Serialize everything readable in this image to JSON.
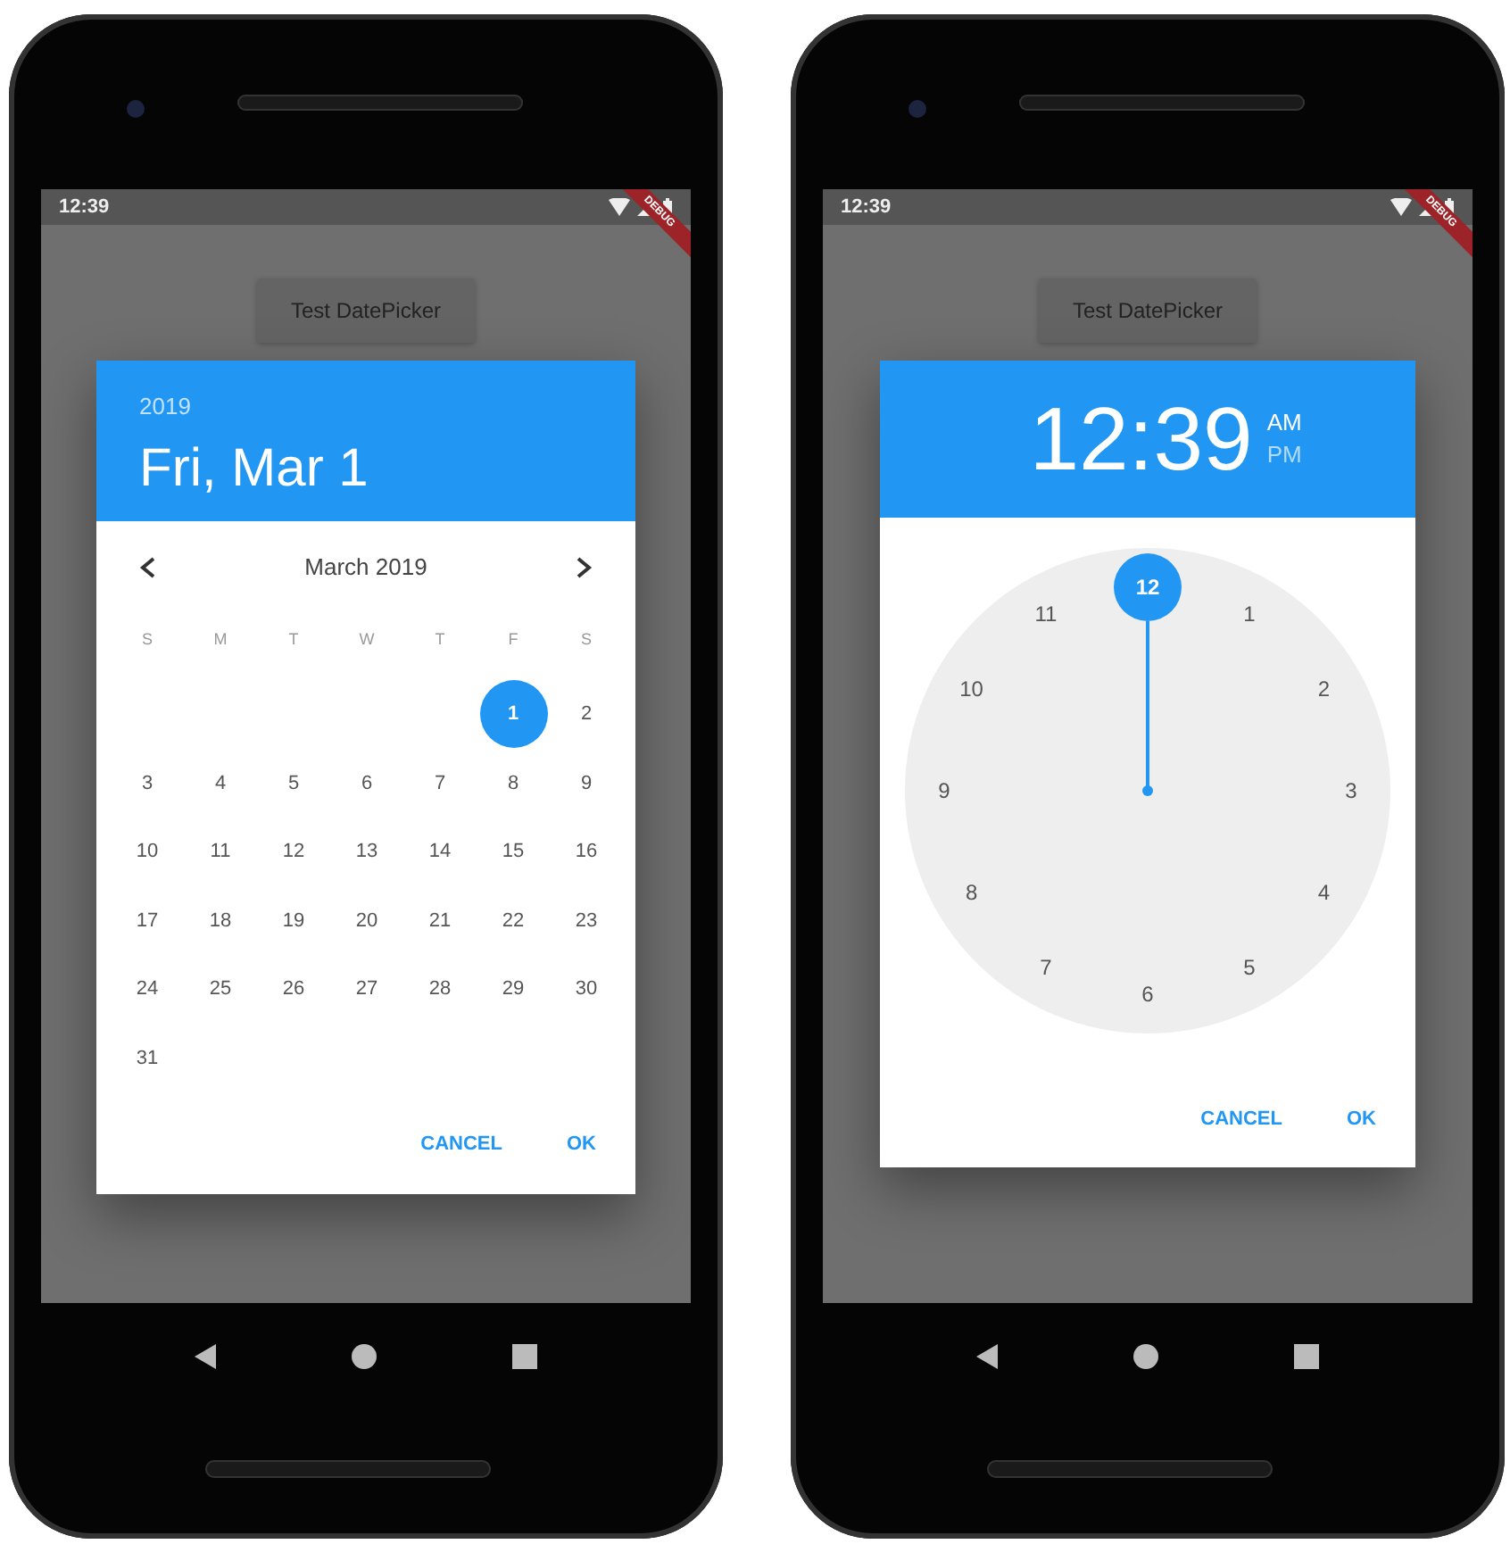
{
  "phones": [
    {
      "status_bar": {
        "time": "12:39",
        "banner": "DEBUG"
      },
      "button": "Test DatePicker",
      "dialog": {
        "kind": "date",
        "year": "2019",
        "date": "Fri, Mar 1",
        "month_label": "March 2019",
        "weekdays": [
          "S",
          "M",
          "T",
          "W",
          "T",
          "F",
          "S"
        ],
        "weeks": [
          [
            {
              "day": "1",
              "selected": true
            },
            {
              "day": "2",
              "selected": false
            }
          ],
          [
            {
              "day": "3",
              "selected": false
            },
            {
              "day": "4",
              "selected": false
            },
            {
              "day": "5",
              "selected": false
            },
            {
              "day": "6",
              "selected": false
            },
            {
              "day": "7",
              "selected": false
            },
            {
              "day": "8",
              "selected": false
            },
            {
              "day": "9",
              "selected": false
            }
          ],
          [
            {
              "day": "10",
              "selected": false
            },
            {
              "day": "11",
              "selected": false
            },
            {
              "day": "12",
              "selected": false
            },
            {
              "day": "13",
              "selected": false
            },
            {
              "day": "14",
              "selected": false
            },
            {
              "day": "15",
              "selected": false
            },
            {
              "day": "16",
              "selected": false
            }
          ],
          [
            {
              "day": "17",
              "selected": false
            },
            {
              "day": "18",
              "selected": false
            },
            {
              "day": "19",
              "selected": false
            },
            {
              "day": "20",
              "selected": false
            },
            {
              "day": "21",
              "selected": false
            },
            {
              "day": "22",
              "selected": false
            },
            {
              "day": "23",
              "selected": false
            }
          ],
          [
            {
              "day": "24",
              "selected": false
            },
            {
              "day": "25",
              "selected": false
            },
            {
              "day": "26",
              "selected": false
            },
            {
              "day": "27",
              "selected": false
            },
            {
              "day": "28",
              "selected": false
            },
            {
              "day": "29",
              "selected": false
            },
            {
              "day": "30",
              "selected": false
            }
          ],
          [
            {
              "day": "31",
              "selected": false
            }
          ]
        ],
        "actions": [
          "CANCEL",
          "OK"
        ]
      }
    },
    {
      "status_bar": {
        "time": "12:39",
        "banner": "DEBUG"
      },
      "button": "Test DatePicker",
      "dialog": {
        "kind": "time",
        "time": "12:39",
        "periods": [
          {
            "label": "AM",
            "selected": true
          },
          {
            "label": "PM",
            "selected": false
          }
        ],
        "dial": [
          {
            "label": "12",
            "selected": true
          },
          {
            "label": "1",
            "selected": false
          },
          {
            "label": "2",
            "selected": false
          },
          {
            "label": "3",
            "selected": false
          },
          {
            "label": "4",
            "selected": false
          },
          {
            "label": "5",
            "selected": false
          },
          {
            "label": "6",
            "selected": false
          },
          {
            "label": "7",
            "selected": false
          },
          {
            "label": "8",
            "selected": false
          },
          {
            "label": "9",
            "selected": false
          },
          {
            "label": "10",
            "selected": false
          },
          {
            "label": "11",
            "selected": false
          }
        ],
        "actions": [
          "CANCEL",
          "OK"
        ]
      }
    }
  ]
}
